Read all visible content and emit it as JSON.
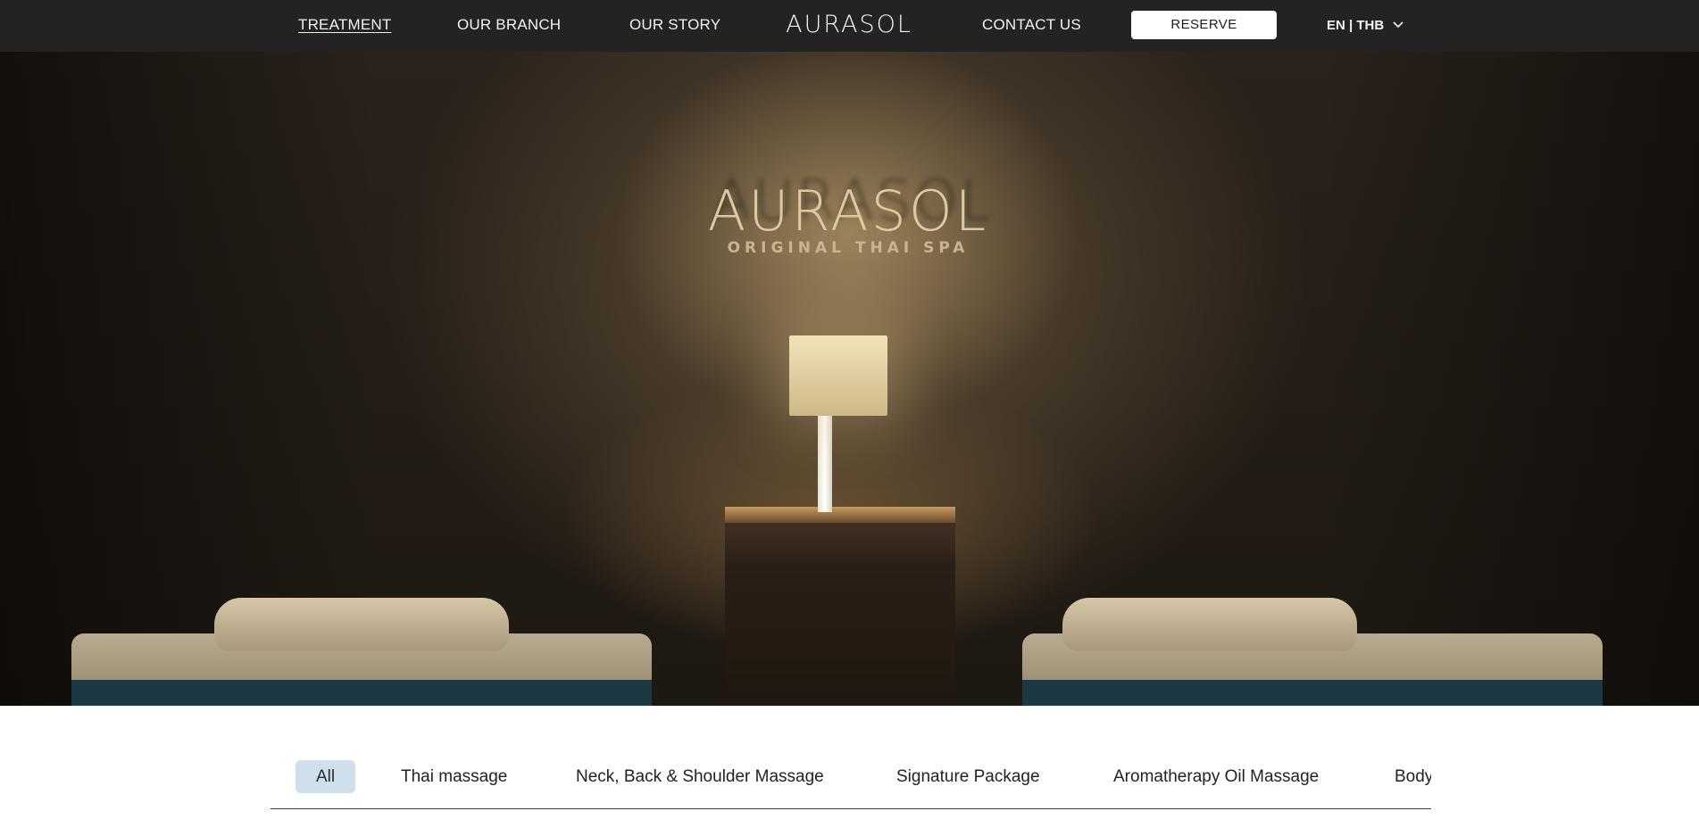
{
  "nav": {
    "links": [
      {
        "label": "TREATMENT",
        "active": true
      },
      {
        "label": "OUR BRANCH",
        "active": false
      },
      {
        "label": "OUR STORY",
        "active": false
      },
      {
        "label": "CONTACT US",
        "active": false
      }
    ],
    "brand": "AURASOL",
    "reserve_label": "RESERVE",
    "language_currency": "EN | THB",
    "dropdown_icon": "chevron-down-icon"
  },
  "hero": {
    "wall_logo": "AURASOL",
    "wall_tagline": "ORIGINAL THAI SPA"
  },
  "categories": {
    "tabs": [
      {
        "label": "All",
        "active": true
      },
      {
        "label": "Thai massage",
        "active": false
      },
      {
        "label": "Neck, Back & Shoulder Massage",
        "active": false
      },
      {
        "label": "Signature Package",
        "active": false
      },
      {
        "label": "Aromatherapy Oil Massage",
        "active": false
      },
      {
        "label": "Body",
        "active": false
      }
    ],
    "active_color": "#cfe0ec"
  },
  "colors": {
    "nav_background": "#232323",
    "nav_text": "#f2f2f2",
    "page_background": "#ffffff"
  }
}
